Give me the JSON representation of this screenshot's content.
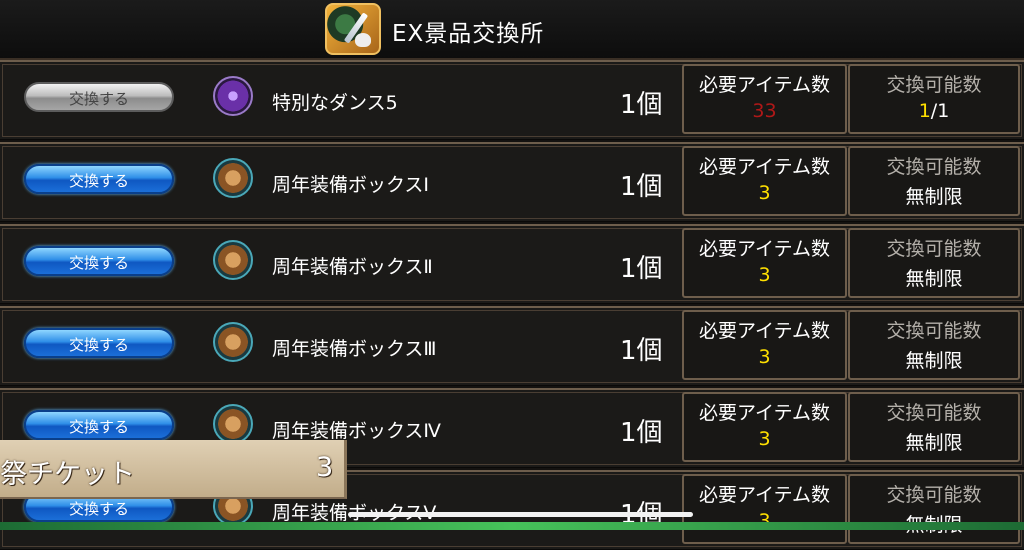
{
  "header": {
    "title": "EX景品交換所",
    "icon": "sword-skull-shop-icon"
  },
  "columns": {
    "required_label": "必要アイテム数",
    "available_label": "交換可能数"
  },
  "rows": [
    {
      "button": "交換する",
      "button_state": "disabled",
      "icon": "dance-figure-icon",
      "name": "特別なダンス5",
      "qty": "1個",
      "required": "33",
      "required_color": "#b01818",
      "available_main": "1",
      "available_suffix": "/1"
    },
    {
      "button": "交換する",
      "button_state": "enabled",
      "icon": "treasure-chest-icon",
      "name": "周年装備ボックスⅠ",
      "qty": "1個",
      "required": "3",
      "required_color": "#ffe000",
      "available": "無制限"
    },
    {
      "button": "交換する",
      "button_state": "enabled",
      "icon": "treasure-chest-icon",
      "name": "周年装備ボックスⅡ",
      "qty": "1個",
      "required": "3",
      "required_color": "#ffe000",
      "available": "無制限"
    },
    {
      "button": "交換する",
      "button_state": "enabled",
      "icon": "treasure-chest-icon",
      "name": "周年装備ボックスⅢ",
      "qty": "1個",
      "required": "3",
      "required_color": "#ffe000",
      "available": "無制限"
    },
    {
      "button": "交換する",
      "button_state": "enabled",
      "icon": "treasure-chest-icon",
      "name": "周年装備ボックスⅣ",
      "qty": "1個",
      "required": "3",
      "required_color": "#ffe000",
      "available": "無制限"
    },
    {
      "button": "交換する",
      "button_state": "enabled",
      "icon": "treasure-chest-icon",
      "name": "周年装備ボックスⅤ",
      "qty": "1個",
      "required": "3",
      "required_color": "#ffe000",
      "available": "無制限"
    }
  ],
  "ticket": {
    "label": "祭チケット",
    "count": "3"
  },
  "colors": {
    "enabled_button": "#1b6fd8",
    "disabled_button": "#a6a6a6",
    "highlight": "#ffe000"
  }
}
